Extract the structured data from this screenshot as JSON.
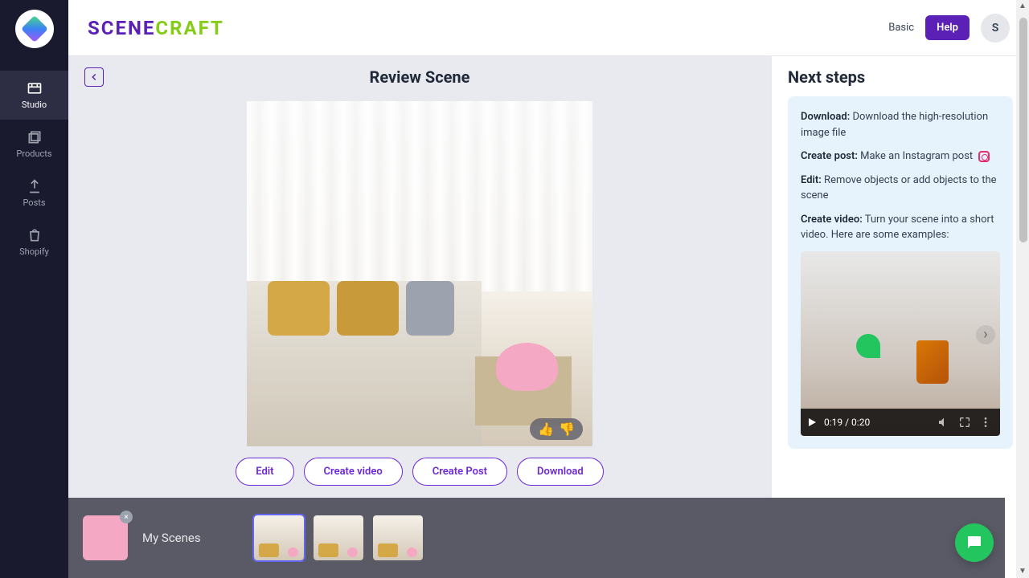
{
  "brand": {
    "part1": "SCENE",
    "part2": "CRAFT"
  },
  "topbar": {
    "plan": "Basic",
    "help": "Help",
    "avatar": "S"
  },
  "nav": {
    "items": [
      {
        "key": "studio",
        "label": "Studio",
        "active": true
      },
      {
        "key": "products",
        "label": "Products"
      },
      {
        "key": "posts",
        "label": "Posts"
      },
      {
        "key": "shopify",
        "label": "Shopify"
      }
    ]
  },
  "page": {
    "title": "Review Scene"
  },
  "actions": {
    "edit": "Edit",
    "create_video": "Create video",
    "create_post": "Create Post",
    "download": "Download"
  },
  "sidebar": {
    "title": "Next steps",
    "steps": [
      {
        "label": "Download:",
        "text": " Download the high-resolution image file"
      },
      {
        "label": "Create post:",
        "text": " Make an Instagram post ",
        "icon": "instagram"
      },
      {
        "label": "Edit:",
        "text": " Remove objects or add objects to the scene"
      },
      {
        "label": "Create video:",
        "text": " Turn your scene into a short video. Here are some examples:"
      }
    ],
    "video": {
      "time": "0:19 / 0:20"
    }
  },
  "tray": {
    "label": "My Scenes",
    "thumbs": 3,
    "selected": 0
  }
}
